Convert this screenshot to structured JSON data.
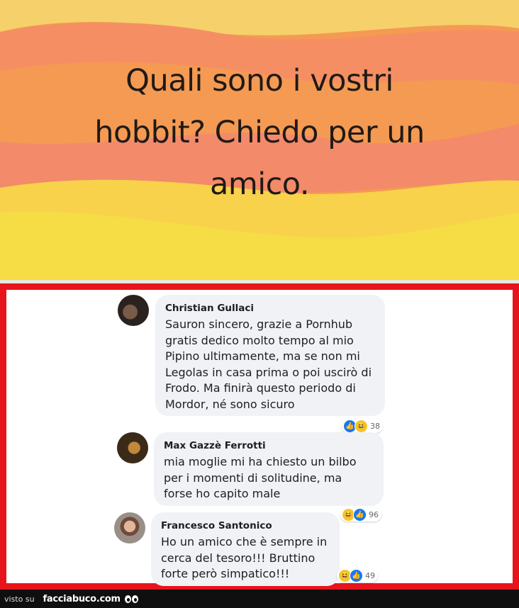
{
  "post": {
    "lines": [
      "Quali sono i vostri",
      "hobbit? Chiedo per un",
      "amico."
    ]
  },
  "comments": [
    {
      "author": "Christian Gullaci",
      "text": "Sauron sincero, grazie a Pornhub gratis dedico molto tempo al mio Pipino ultimamente, ma se non mi Legolas in casa prima o poi uscirò di Frodo. Ma finirà questo periodo di Mordor, né sono sicuro",
      "reactions": [
        "like-icon",
        "haha-icon"
      ],
      "reaction_count": "38"
    },
    {
      "author": "Max Gazzè Ferrotti",
      "text": "mia moglie mi ha chiesto un bilbo per i momenti di solitudine, ma forse ho capito male",
      "reactions": [
        "haha-icon",
        "like-icon"
      ],
      "reaction_count": "96"
    },
    {
      "author": "Francesco Santonico",
      "text": "Ho un amico che è sempre in cerca del tesoro!!! Bruttino forte però simpatico!!!",
      "reactions": [
        "haha-icon",
        "like-icon"
      ],
      "reaction_count": "49"
    }
  ],
  "footer": {
    "visto": "visto su",
    "site": "facciabuco.com"
  },
  "colors": {
    "frame": "#e8141c",
    "bubble": "#f0f2f5",
    "like": "#1877f2",
    "haha": "#f7c42b"
  }
}
